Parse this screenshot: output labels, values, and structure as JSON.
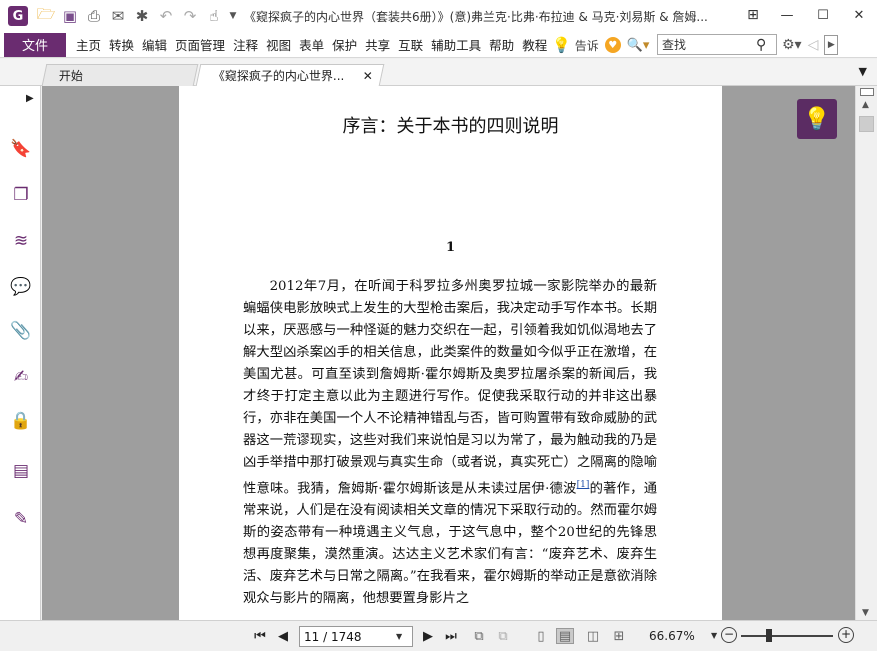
{
  "titlebar": {
    "logo_letter": "G",
    "title": "《窥探疯子的内心世界（套装共6册）》(意)弗兰克·比弗·布拉迪 & 马克·刘易斯 & 詹姆...",
    "undo_icon": "undo-icon",
    "redo_icon": "redo-icon"
  },
  "menubar": {
    "file_label": "文件",
    "items": [
      "主页",
      "转换",
      "编辑",
      "页面管理",
      "注释",
      "视图",
      "表单",
      "保护",
      "共享",
      "互联",
      "辅助工具",
      "帮助",
      "教程"
    ],
    "tell_me": "告诉",
    "search_placeholder": "查找"
  },
  "tabs": {
    "home_label": "开始",
    "doc_label": "《窥探疯子的内心世界..."
  },
  "document": {
    "page_title": "序言：关于本书的四则说明",
    "section_number": "1",
    "paragraph_before_note": "2012年7月，在听闻于科罗拉多州奥罗拉城一家影院举办的最新蝙蝠侠电影放映式上发生的大型枪击案后，我决定动手写作本书。长期以来，厌恶感与一种怪诞的魅力交织在一起，引领着我如饥似渴地去了解大型凶杀案凶手的相关信息，此类案件的数量如今似乎正在激增，在美国尤甚。可直至读到詹姆斯·霍尔姆斯及奥罗拉屠杀案的新闻后，我才终于打定主意以此为主题进行写作。促使我采取行动的并非这出暴行，亦非在美国一个人不论精神错乱与否，皆可购置带有致命威胁的武器这一荒谬现实，这些对我们来说怕是习以为常了，最为触动我的乃是凶手举措中那打破景观与真实生命（或者说，真实死亡）之隔离的隐喻性意味。我猜，詹姆斯·霍尔姆斯该是从未读过居伊·德波",
    "footnote_ref": "[1]",
    "paragraph_after_note": "的著作，通常来说，人们是在没有阅读相关文章的情况下采取行动的。然而霍尔姆斯的姿态带有一种境遇主义气息，于这气息中，整个20世纪的先锋思想再度聚集，漠然重演。达达主义艺术家们有言：“废弃艺术、废弃生活、废弃艺术与日常之隔离。”在我看来，霍尔姆斯的举动正是意欲消除观众与影片的隔离，他想要置身影片之"
  },
  "statusbar": {
    "page_value": "11 / 1748",
    "zoom_value": "66.67%",
    "zoom_level_fraction": 0.3
  }
}
